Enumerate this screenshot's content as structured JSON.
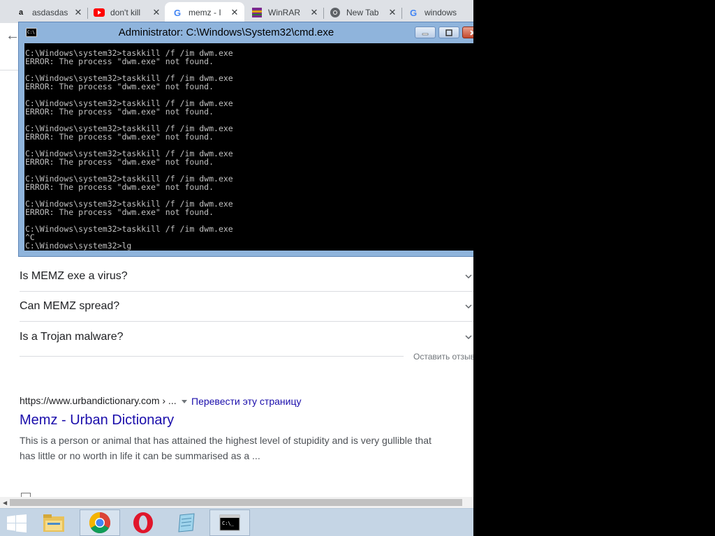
{
  "colors": {
    "link": "#1a0dab",
    "cmd_text": "#c0c0c0",
    "taskbar": "#c5d5e5",
    "tab_strip": "#dee1e6"
  },
  "browser": {
    "tabs": [
      {
        "title": "asdasdas",
        "icon": "amazon-icon",
        "active": false
      },
      {
        "title": "don't kill",
        "icon": "youtube-icon",
        "active": false
      },
      {
        "title": "memz - I",
        "icon": "google-icon",
        "active": true
      },
      {
        "title": "WinRAR",
        "icon": "winrar-icon",
        "active": false
      },
      {
        "title": "New Tab",
        "icon": "chrome-icon",
        "active": false
      },
      {
        "title": "windows",
        "icon": "google-icon",
        "active": false
      }
    ]
  },
  "cmd": {
    "title": "Administrator: C:\\Windows\\System32\\cmd.exe",
    "icon_text": "C:\\",
    "lines": [
      "C:\\Windows\\system32>taskkill /f /im dwm.exe",
      "ERROR: The process \"dwm.exe\" not found.",
      "",
      "C:\\Windows\\system32>taskkill /f /im dwm.exe",
      "ERROR: The process \"dwm.exe\" not found.",
      "",
      "C:\\Windows\\system32>taskkill /f /im dwm.exe",
      "ERROR: The process \"dwm.exe\" not found.",
      "",
      "C:\\Windows\\system32>taskkill /f /im dwm.exe",
      "ERROR: The process \"dwm.exe\" not found.",
      "",
      "C:\\Windows\\system32>taskkill /f /im dwm.exe",
      "ERROR: The process \"dwm.exe\" not found.",
      "",
      "C:\\Windows\\system32>taskkill /f /im dwm.exe",
      "ERROR: The process \"dwm.exe\" not found.",
      "",
      "C:\\Windows\\system32>taskkill /f /im dwm.exe",
      "ERROR: The process \"dwm.exe\" not found.",
      "",
      "C:\\Windows\\system32>taskkill /f /im dwm.exe",
      "^C",
      "C:\\Windows\\system32>lg"
    ]
  },
  "page": {
    "faq": [
      {
        "question": "Is MEMZ exe a virus?"
      },
      {
        "question": "Can MEMZ spread?"
      },
      {
        "question": "Is a Trojan malware?"
      }
    ],
    "feedback_label": "Оставить отзыв",
    "result": {
      "url": "https://www.urbandictionary.com › ...",
      "translate_label": "Перевести эту страницу",
      "title": "Memz - Urban Dictionary",
      "snippet": "This is a person or animal that has attained the highest level of stupidity and is very gullible that has little or no worth in life it can be summarised as a ..."
    }
  },
  "taskbar": {
    "items": [
      {
        "icon": "windows-start-icon"
      },
      {
        "icon": "file-explorer-icon"
      },
      {
        "icon": "chrome-icon"
      },
      {
        "icon": "opera-icon"
      },
      {
        "icon": "notepad-icon"
      },
      {
        "icon": "command-prompt-icon"
      }
    ]
  }
}
